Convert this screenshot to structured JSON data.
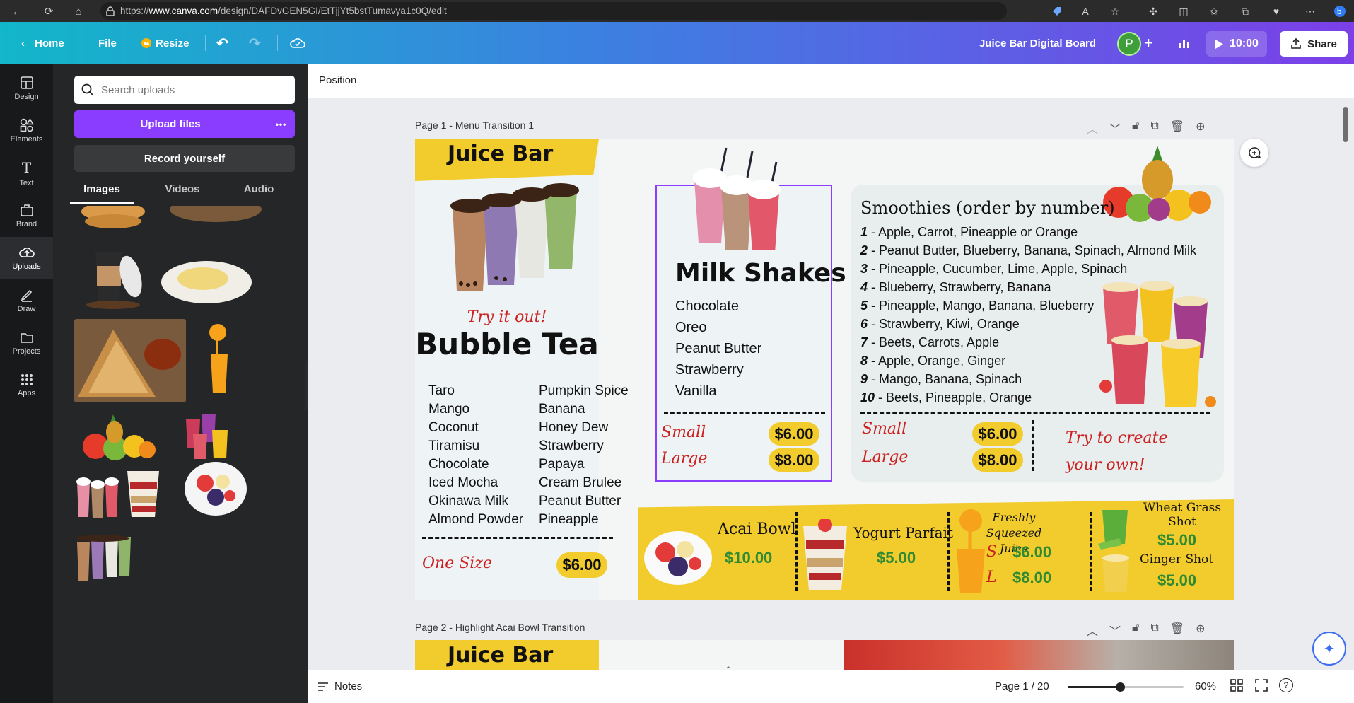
{
  "browser": {
    "url_prefix": "https://",
    "url_domain": "www.canva.com",
    "url_path": "/design/DAFDvGEN5GI/EtTjjYt5bstTumavya1c0Q/edit"
  },
  "header": {
    "home": "Home",
    "file": "File",
    "resize": "Resize",
    "doc_title": "Juice Bar Digital Board",
    "avatar_initial": "P",
    "present_time": "10:00",
    "share": "Share"
  },
  "rail": {
    "items": [
      {
        "label": "Design",
        "icon": "design-icon"
      },
      {
        "label": "Elements",
        "icon": "elements-icon"
      },
      {
        "label": "Text",
        "icon": "text-icon"
      },
      {
        "label": "Brand",
        "icon": "brand-icon"
      },
      {
        "label": "Uploads",
        "icon": "uploads-icon"
      },
      {
        "label": "Draw",
        "icon": "draw-icon"
      },
      {
        "label": "Projects",
        "icon": "projects-icon"
      },
      {
        "label": "Apps",
        "icon": "apps-icon"
      }
    ]
  },
  "panel": {
    "search_placeholder": "Search uploads",
    "upload_button": "Upload files",
    "more_glyph": "•••",
    "record_button": "Record yourself",
    "tabs": [
      "Images",
      "Videos",
      "Audio"
    ]
  },
  "context_bar": {
    "position": "Position"
  },
  "pages": {
    "page1_label": "Page 1 - Menu Transition 1",
    "page2_label": "Page 2 - Highlight Acai Bowl Transition"
  },
  "menu": {
    "brand": "Juice Bar",
    "bubble_tea": {
      "tagline": "Try it out!",
      "title": "Bubble Tea",
      "left": [
        "Taro",
        "Mango",
        "Coconut",
        "Tiramisu",
        "Chocolate",
        "Iced Mocha",
        "Okinawa Milk",
        "Almond Powder"
      ],
      "right": [
        "Pumpkin Spice",
        "Banana",
        "Honey Dew",
        "Strawberry",
        "Papaya",
        "Cream Brulee",
        "Peanut Butter",
        "Pineapple"
      ],
      "size_label": "One Size",
      "price": "$6.00"
    },
    "milkshakes": {
      "title": "Milk Shakes",
      "items": [
        "Chocolate",
        "Oreo",
        "Peanut Butter",
        "Strawberry",
        "Vanilla"
      ],
      "small_label": "Small",
      "small_price": "$6.00",
      "large_label": "Large",
      "large_price": "$8.00"
    },
    "smoothies": {
      "title": "Smoothies (order by number)",
      "items": [
        {
          "num": "1",
          "text": " - Apple, Carrot, Pineapple or Orange"
        },
        {
          "num": "2",
          "text": " - Peanut Butter, Blueberry, Banana, Spinach, Almond Milk"
        },
        {
          "num": "3",
          "text": " - Pineapple, Cucumber, Lime, Apple, Spinach"
        },
        {
          "num": "4",
          "text": " - Blueberry, Strawberry, Banana"
        },
        {
          "num": "5",
          "text": " - Pineapple, Mango, Banana, Blueberry"
        },
        {
          "num": "6",
          "text": " - Strawberry, Kiwi, Orange"
        },
        {
          "num": "7",
          "text": " - Beets, Carrots, Apple"
        },
        {
          "num": "8",
          "text": " - Apple, Orange, Ginger"
        },
        {
          "num": "9",
          "text": " - Mango, Banana, Spinach"
        },
        {
          "num": "10",
          "text": " - Beets, Pineapple, Orange"
        }
      ],
      "small_label": "Small",
      "small_price": "$6.00",
      "large_label": "Large",
      "large_price": "$8.00",
      "try_line1": "Try to create",
      "try_line2": "your own!"
    },
    "bottom": {
      "acai_name": "Acai Bowl",
      "acai_price": "$10.00",
      "parfait_name": "Yogurt Parfait",
      "parfait_price": "$5.00",
      "juice_line1": "Freshly",
      "juice_line2": "Squeezed Juice",
      "juice_s": "S",
      "juice_s_price": "$6.00",
      "juice_l": "L",
      "juice_l_price": "$8.00",
      "wheat_line1": "Wheat Grass",
      "wheat_line2": "Shot",
      "wheat_price": "$5.00",
      "ginger_name": "Ginger Shot",
      "ginger_price": "$5.00"
    }
  },
  "bottom_bar": {
    "notes": "Notes",
    "page_indicator": "Page 1 / 20",
    "zoom": "60%",
    "zoom_level": 0.45
  },
  "colors": {
    "accent_purple": "#8b3dff",
    "menu_yellow": "#f2cc2c",
    "script_red": "#cc1f1f"
  }
}
